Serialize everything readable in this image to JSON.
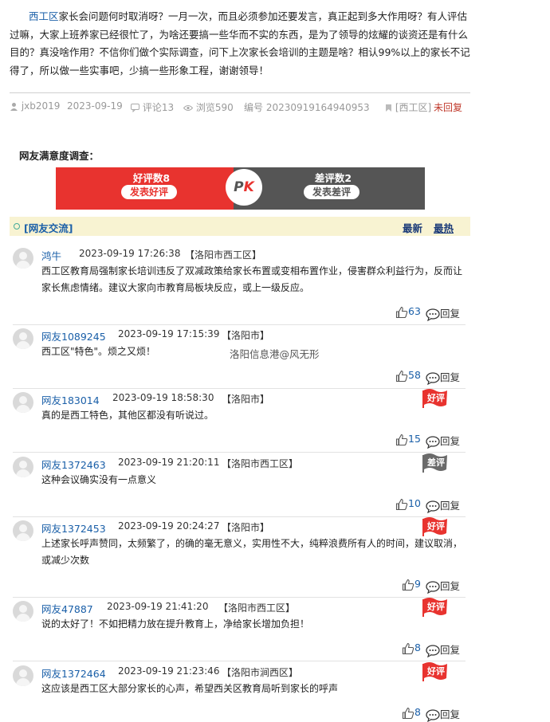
{
  "post": {
    "district": "西工区",
    "text": "家长会问题何时取消呀？一月一次，而且必须参加还要发言，真正起到多大作用呀？有人评估过嘛，大家上班养家已经很忙了，为啥还要搞一些华而不实的东西，是为了领导的炫耀的谈资还是有什么目的？真没啥作用？不信你们做个实际调查，问下上次家长会培训的主题是啥？相认99%以上的家长不记得了，所以做一些实事吧，少搞一些形象工程，谢谢领导！",
    "author": "jxb2019",
    "date": "2023-09-19",
    "comments_label": "评论13",
    "views_label": "浏览590",
    "id_label": "编号 20230919164940953",
    "tag": "[西工区]",
    "status": "未回复"
  },
  "survey": {
    "title": "网友满意度调查：",
    "good_label": "好评数8",
    "good_button": "发表好评",
    "bad_label": "差评数2",
    "bad_button": "发表差评",
    "pk_p": "P",
    "pk_k": "K"
  },
  "watermarks": [
    "洛阳信息港@风无形"
  ],
  "comments_bar": {
    "title": "[网友交流]",
    "sort_latest": "最新",
    "sort_hottest": "最热"
  },
  "comments": [
    {
      "user": "鸿牛",
      "time": "2023-09-19 17:26:38",
      "loc": "【洛阳市西工区】",
      "body": "西工区教育局强制家长培训违反了双减政策给家长布置或变相布置作业，侵害群众利益行为，反而让家长焦虑情绪。建议大家向市教育局板块反应，或上一级反应。",
      "likes": "63",
      "reply": "回复",
      "flag": ""
    },
    {
      "user": "网友1089245",
      "time": "2023-09-19 17:15:39",
      "loc": "【洛阳市】",
      "body": "西工区\"特色\"。烦之又烦！",
      "likes": "58",
      "reply": "回复",
      "flag": ""
    },
    {
      "user": "网友183014",
      "time": "2023-09-19 18:58:30",
      "loc": "【洛阳市】",
      "body": "真的是西工特色，其他区都没有听说过。",
      "likes": "15",
      "reply": "回复",
      "flag": "好评"
    },
    {
      "user": "网友1372463",
      "time": "2023-09-19 21:20:11",
      "loc": "【洛阳市西工区】",
      "body": "这种会议确实没有一点意义",
      "likes": "10",
      "reply": "回复",
      "flag": "差评"
    },
    {
      "user": "网友1372453",
      "time": "2023-09-19 20:24:27",
      "loc": "【洛阳市】",
      "body": "上述家长呼声赞同，太频繁了，的确的毫无意义，实用性不大，纯粹浪费所有人的时间，建议取消，或减少次数",
      "likes": "9",
      "reply": "回复",
      "flag": "好评"
    },
    {
      "user": "网友47887",
      "time": "2023-09-19 21:41:20",
      "loc": "【洛阳市西工区】",
      "body": "说的太好了！不如把精力放在提升教育上，净给家长增加负担！",
      "likes": "8",
      "reply": "回复",
      "flag": "好评"
    },
    {
      "user": "网友1372464",
      "time": "2023-09-19 21:23:46",
      "loc": "【洛阳市涧西区】",
      "body": "这应该是西工区大部分家长的心声，希望西关区教育局听到家长的呼声",
      "likes": "8",
      "reply": "回复",
      "flag": "好评"
    }
  ]
}
